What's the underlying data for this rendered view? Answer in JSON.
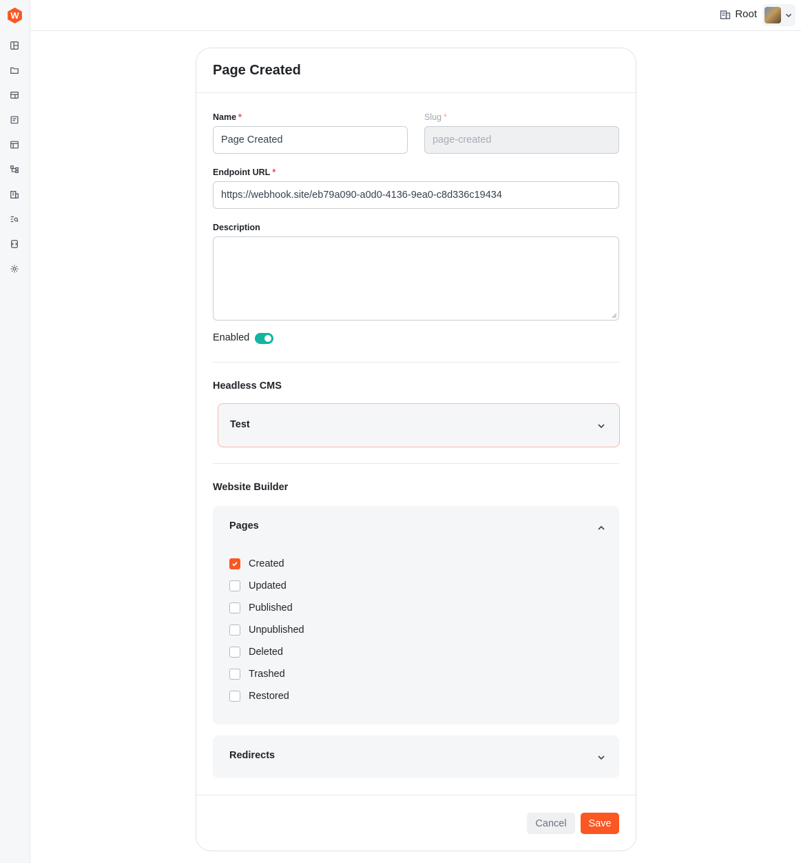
{
  "app": {
    "logo_letter": "W"
  },
  "sidebar": {
    "items": [
      {
        "icon": "dashboard-icon"
      },
      {
        "icon": "folder-icon"
      },
      {
        "icon": "layout-icon"
      },
      {
        "icon": "document-icon"
      },
      {
        "icon": "table-icon"
      },
      {
        "icon": "hierarchy-icon"
      },
      {
        "icon": "building-icon"
      },
      {
        "icon": "search-list-icon"
      },
      {
        "icon": "api-icon"
      },
      {
        "icon": "gear-icon"
      }
    ]
  },
  "header": {
    "tenant_label": "Root"
  },
  "form": {
    "title": "Page Created",
    "name_label": "Name",
    "name_value": "Page Created",
    "slug_label": "Slug",
    "slug_value": "page-created",
    "required_mark": "*",
    "endpoint_label": "Endpoint URL",
    "endpoint_value": "https://webhook.site/eb79a090-a0d0-4136-9ea0-c8d336c19434",
    "description_label": "Description",
    "description_value": "",
    "enabled_label": "Enabled",
    "enabled": true
  },
  "sections": {
    "headless_cms": {
      "title": "Headless CMS",
      "group_title": "Test"
    },
    "website_builder": {
      "title": "Website Builder",
      "pages_title": "Pages",
      "events": [
        {
          "label": "Created",
          "checked": true
        },
        {
          "label": "Updated",
          "checked": false
        },
        {
          "label": "Published",
          "checked": false
        },
        {
          "label": "Unpublished",
          "checked": false
        },
        {
          "label": "Deleted",
          "checked": false
        },
        {
          "label": "Trashed",
          "checked": false
        },
        {
          "label": "Restored",
          "checked": false
        }
      ],
      "redirects_title": "Redirects"
    }
  },
  "footer": {
    "cancel_label": "Cancel",
    "save_label": "Save"
  },
  "colors": {
    "accent": "#fa5723",
    "toggle_on": "#12b5a0"
  }
}
